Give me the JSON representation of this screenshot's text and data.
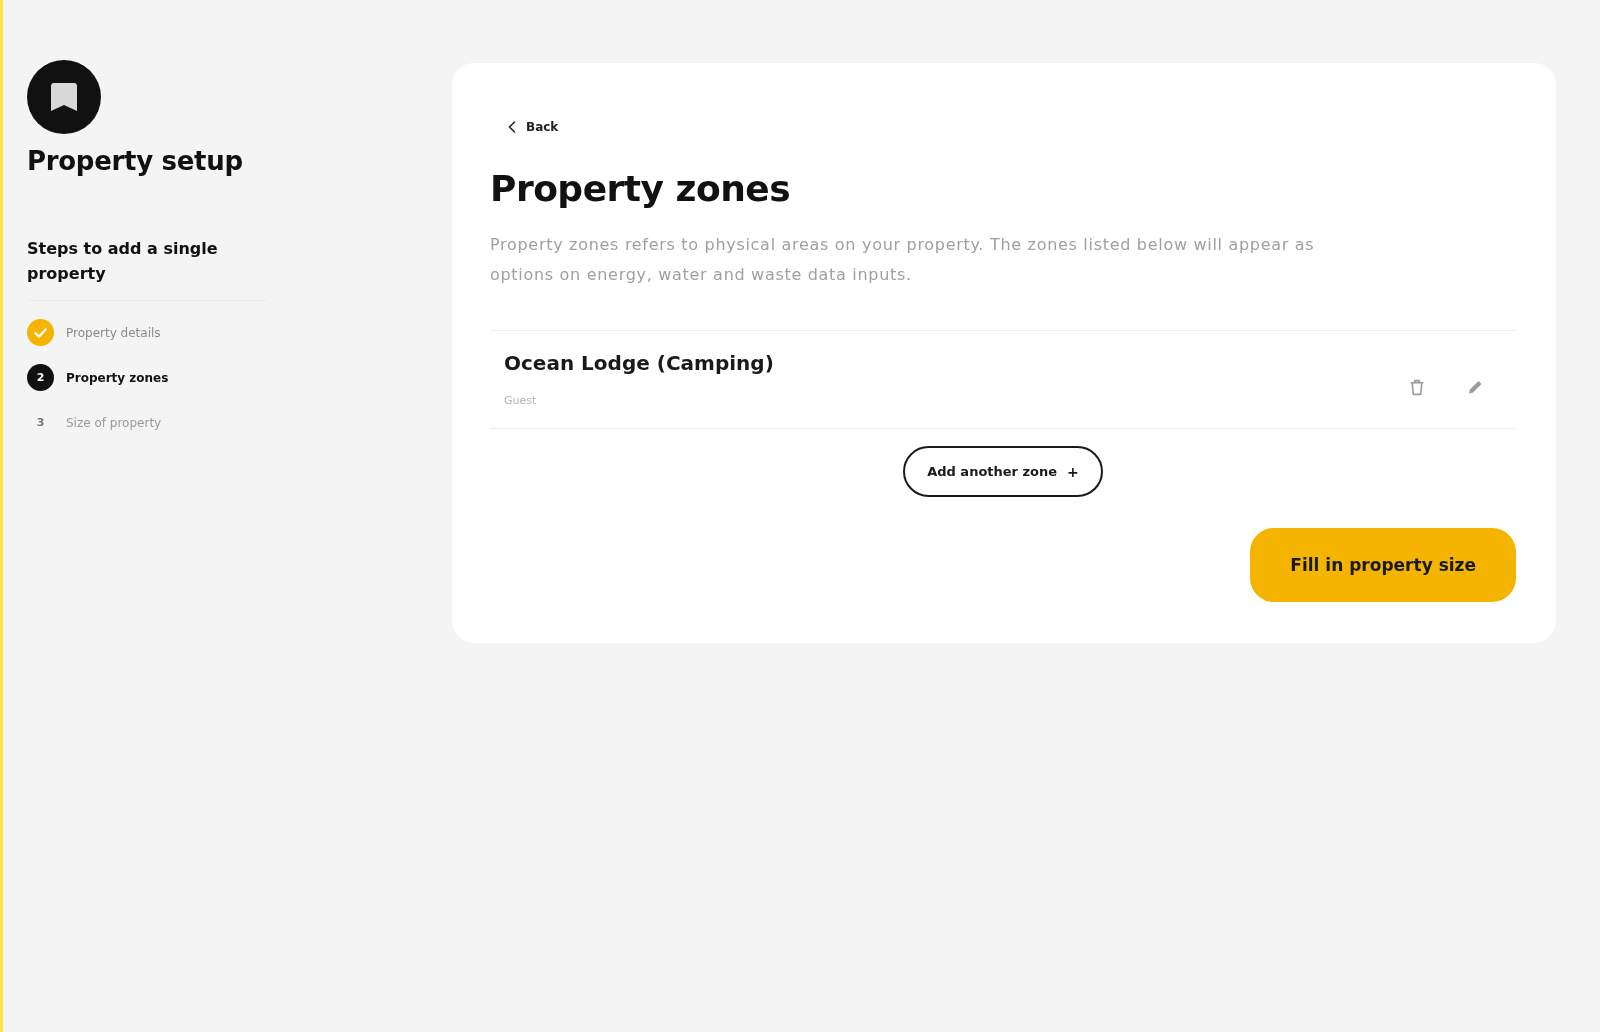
{
  "sidebar": {
    "title": "Property setup",
    "steps_heading": "Steps to add a single property",
    "steps": [
      {
        "label": "Property details",
        "completed": true,
        "selected": false
      },
      {
        "label": "Property zones",
        "completed": false,
        "selected": true,
        "number": "2"
      },
      {
        "label": "Size of property",
        "completed": false,
        "selected": false,
        "number": "3"
      }
    ]
  },
  "main": {
    "back_link": "Back",
    "title": "Property zones",
    "description": "Property zones refers to physical areas on your property. The zones listed below will appear as options on energy, water and waste data inputs.",
    "zones": [
      {
        "name": "Ocean Lodge (Camping)",
        "type": "Guest"
      }
    ],
    "add_button": "Add another zone",
    "add_icon": "+",
    "primary_button": "Fill in property size"
  }
}
